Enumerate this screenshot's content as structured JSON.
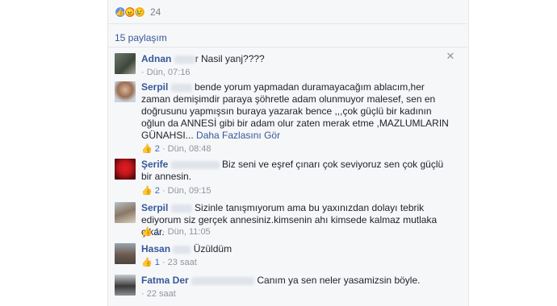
{
  "reactions": {
    "count": "24"
  },
  "shares": {
    "label": "15 paylaşım"
  },
  "comments": [
    {
      "author": "Adnan",
      "text": "r Nasil yanj????",
      "meta_prefix": "· ",
      "time": "Dün, 07:16",
      "likes": ""
    },
    {
      "author": "Serpil",
      "text": "bende yorum yapmadan duramayacağım ablacım,her zaman demişimdir paraya şöhretle adam olunmuyor malesef, sen en doğrusunu yapmışsın buraya yazarak bence ,,,çok güçlü bir kadının oğlun da ANNESİ gibi bir adam olur zaten merak etme ,MAZLUMLARIN GÜNAHSI...",
      "more": "Daha Fazlasını Gör",
      "meta_prefix": "",
      "time": "Dün, 08:48",
      "likes": "2"
    },
    {
      "author": "Şerife",
      "text": "Biz seni ve eşref çınarı çok seviyoruz sen çok güçlü bir annesin.",
      "meta_prefix": "",
      "time": "Dün, 09:15",
      "likes": "2"
    },
    {
      "author": "Serpil",
      "text": "Sizinle tanışmıyorum ama bu yaxınızdan dolayı tebrik ediyorum siz gerçek annesiniz.kimsenin ahı kimsede kalmaz mutlaka çıkar.",
      "meta_prefix": "",
      "time": "Dün, 11:05",
      "likes": "1"
    },
    {
      "author": "Hasan",
      "text": "Üzüldüm",
      "meta_prefix": "",
      "time": "23 saat",
      "likes": "1"
    },
    {
      "author": "Fatma Der",
      "text": "Canım ya sen neler yasamizsin böyle.",
      "meta_prefix": "· ",
      "time": "22 saat",
      "likes": ""
    }
  ],
  "icons": {
    "like": "like-icon",
    "close": "close-icon"
  },
  "colors": {
    "link": "#365899",
    "meta": "#90949c",
    "like_blue": "#4267b2"
  }
}
